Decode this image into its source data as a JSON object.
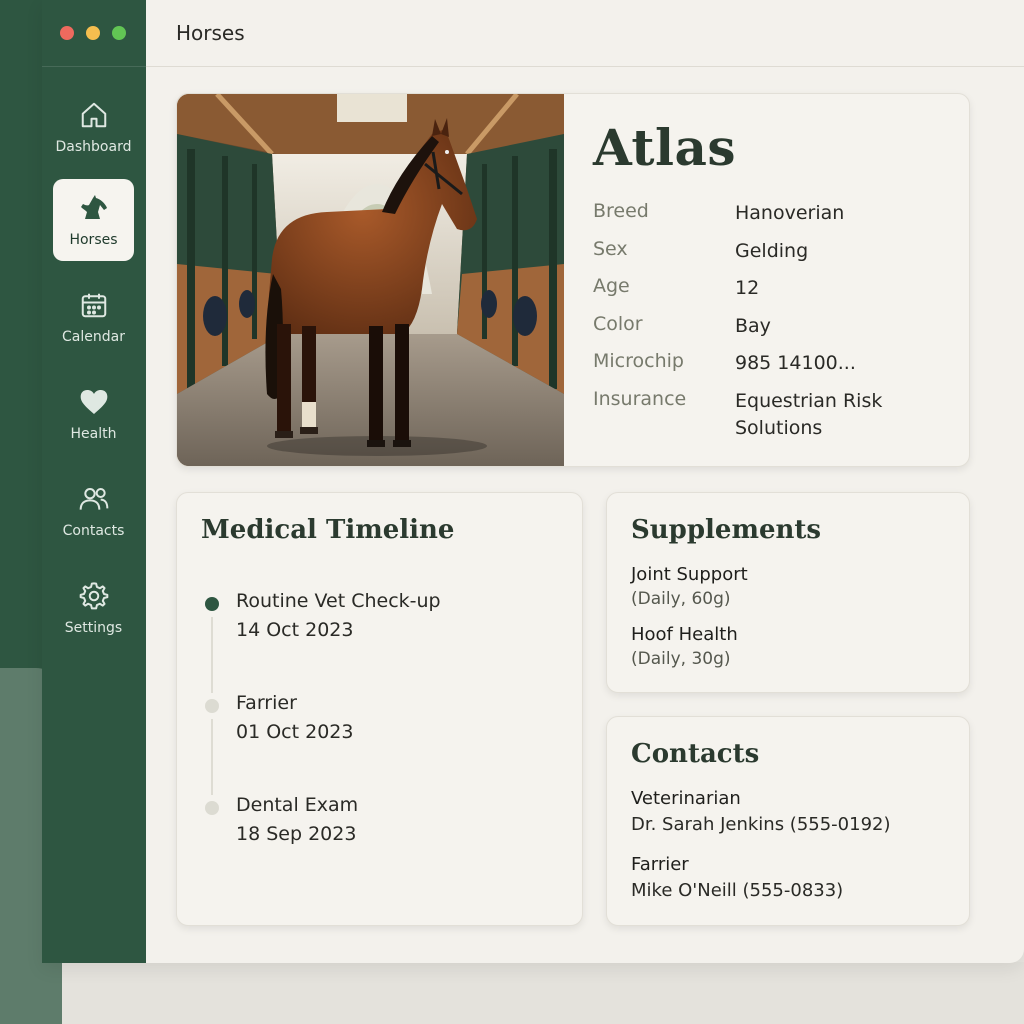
{
  "app": {
    "page_title": "Horses"
  },
  "sidebar": {
    "items": [
      {
        "label": "Dashboard",
        "icon": "home-icon",
        "active": false
      },
      {
        "label": "Horses",
        "icon": "horse-icon",
        "active": true
      },
      {
        "label": "Calendar",
        "icon": "calendar-icon",
        "active": false
      },
      {
        "label": "Health",
        "icon": "heart-icon",
        "active": false
      },
      {
        "label": "Contacts",
        "icon": "people-icon",
        "active": false
      },
      {
        "label": "Settings",
        "icon": "gear-icon",
        "active": false
      }
    ]
  },
  "horse": {
    "name": "Atlas",
    "photo_alt": "horse-photo",
    "attributes": [
      {
        "label": "Breed",
        "value": "Hanoverian"
      },
      {
        "label": "Sex",
        "value": "Gelding"
      },
      {
        "label": "Age",
        "value": "12"
      },
      {
        "label": "Color",
        "value": "Bay"
      },
      {
        "label": "Microchip",
        "value": "985 14100..."
      },
      {
        "label": "Insurance",
        "value": "Equestrian Risk Solutions"
      }
    ]
  },
  "medical": {
    "title": "Medical Timeline",
    "events": [
      {
        "title": "Routine Vet Check-up",
        "date": "14 Oct 2023",
        "status": "current"
      },
      {
        "title": "Farrier",
        "date": "01 Oct 2023",
        "status": "past"
      },
      {
        "title": "Dental Exam",
        "date": "18 Sep 2023",
        "status": "past"
      }
    ]
  },
  "supplements": {
    "title": "Supplements",
    "items": [
      {
        "name": "Joint Support",
        "detail": "(Daily, 60g)"
      },
      {
        "name": "Hoof Health",
        "detail": "(Daily, 30g)"
      }
    ]
  },
  "contacts": {
    "title": "Contacts",
    "items": [
      {
        "role": "Veterinarian",
        "detail": "Dr. Sarah Jenkins (555-0192)"
      },
      {
        "role": "Farrier",
        "detail": "Mike O'Neill (555-0833)"
      }
    ]
  },
  "colors": {
    "sidebar": "#2e5641",
    "accent": "#2e5641",
    "background": "#f3f1ec"
  }
}
